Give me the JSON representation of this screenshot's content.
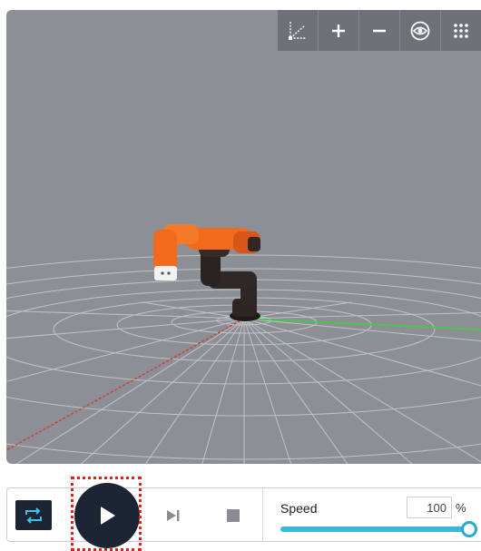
{
  "toolbar": {
    "buttons": [
      {
        "icon": "axes-icon"
      },
      {
        "icon": "zoom-in-icon"
      },
      {
        "icon": "zoom-out-icon"
      },
      {
        "icon": "eye-icon"
      },
      {
        "icon": "grid-menu-icon"
      }
    ]
  },
  "controls": {
    "speed_label": "Speed",
    "speed_value": "100",
    "speed_unit": "%",
    "speed_fraction": 1.0
  },
  "colors": {
    "viewport_bg": "#8c8f96",
    "toolbar_bg": "#6e7178",
    "button_dark": "#1d2535",
    "loop_icon": "#3ec3e8",
    "accent": "#3ab8d9",
    "robot_orange": "#f26b1d",
    "robot_dark": "#2c2523",
    "x_axis": "#d13a3a",
    "y_axis": "#3ecf3e",
    "focus_outline": "#e0201b"
  }
}
